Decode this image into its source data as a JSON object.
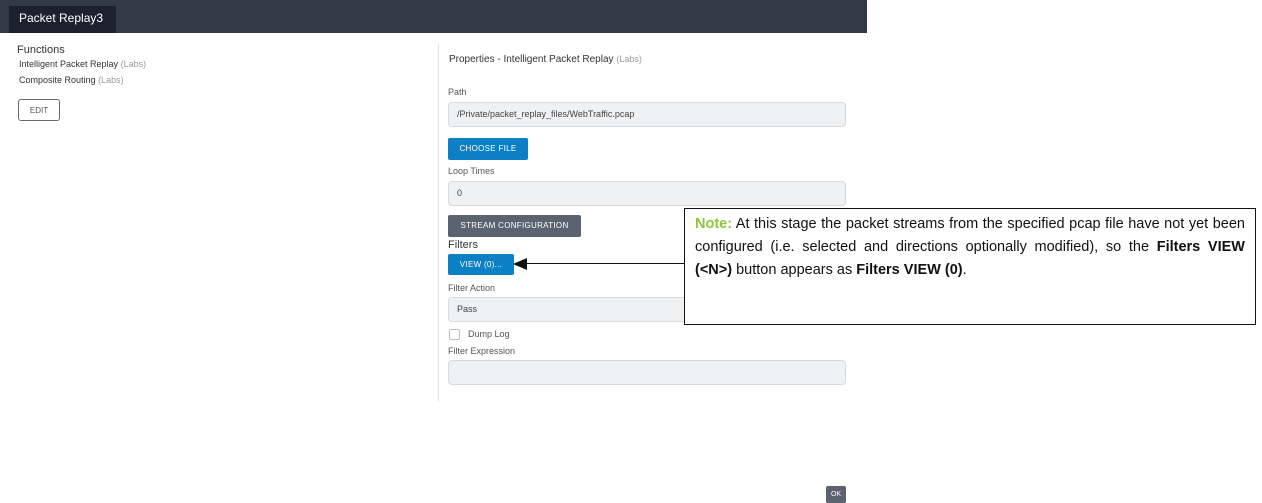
{
  "header": {
    "tab_label": "Packet Replay3"
  },
  "functions": {
    "title": "Functions",
    "items": [
      {
        "label": "Intelligent Packet Replay",
        "tag": "(Labs)"
      },
      {
        "label": "Composite Routing",
        "tag": "(Labs)"
      }
    ],
    "edit_label": "EDIT"
  },
  "properties": {
    "title_prefix": "Properties  - Intelligent Packet Replay",
    "title_tag": "(Labs)",
    "path_label": "Path",
    "path_value": "/Private/packet_replay_files/WebTraffic.pcap",
    "choose_file_label": "CHOOSE FILE",
    "loop_times_label": "Loop Times",
    "loop_times_value": "0",
    "stream_config_label": "STREAM CONFIGURATION",
    "filters_label": "Filters",
    "view_label": "VIEW (0)...",
    "filter_action_label": "Filter Action",
    "filter_action_value": "Pass",
    "dump_log_label": "Dump Log",
    "dump_log_checked": false,
    "filter_expression_label": "Filter Expression",
    "filter_expression_value": ""
  },
  "note": {
    "head": "Note:",
    "text1": " At this stage the packet streams from the specified pcap file have not yet been configured (i.e. selected and directions optionally modified), so the ",
    "bold1": "Filters VIEW (<N>)",
    "text2": " button appears as ",
    "bold2": "Filters VIEW (0)",
    "text3": "."
  },
  "footer": {
    "ok_label": "OK"
  },
  "colors": {
    "topbar": "#323a48",
    "tab_active": "#1c222d",
    "primary_button": "#0b80c4",
    "secondary_button": "#5b6270",
    "note_accent": "#8cc63f"
  }
}
